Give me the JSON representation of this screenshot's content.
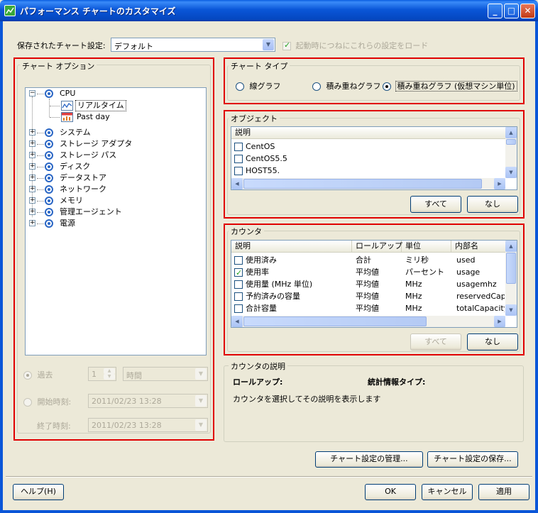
{
  "window": {
    "title": "パフォーマンス チャートのカスタマイズ",
    "minimize": "_",
    "maximize": "□",
    "close": "✕"
  },
  "saved_settings": {
    "label": "保存されたチャート設定:",
    "value": "デフォルト",
    "load_on_startup": "起動時につねにこれらの設定をロード"
  },
  "chart_options": {
    "title": "チャート オプション",
    "tree": {
      "cpu": "CPU",
      "realtime": "リアルタイム",
      "past_day": "Past day",
      "items": [
        "システム",
        "ストレージ アダプタ",
        "ストレージ パス",
        "ディスク",
        "データストア",
        "ネットワーク",
        "メモリ",
        "管理エージェント",
        "電源"
      ]
    },
    "past_label": "過去",
    "past_value": "1",
    "past_unit": "時間",
    "start_label": "開始時刻:",
    "start_value": "2011/02/23 13:28",
    "end_label": "終了時刻:",
    "end_value": "2011/02/23 13:28"
  },
  "chart_type": {
    "title": "チャート タイプ",
    "options": [
      "線グラフ",
      "積み重ねグラフ",
      "積み重ねグラフ (仮想マシン単位)"
    ],
    "selected_index": 2
  },
  "objects": {
    "title": "オブジェクト",
    "header": "説明",
    "items": [
      "CentOS",
      "CentOS5.5",
      "HOST55."
    ],
    "all_button": "すべて",
    "none_button": "なし"
  },
  "counters": {
    "title": "カウンタ",
    "headers": [
      "説明",
      "ロールアップ",
      "単位",
      "内部名"
    ],
    "rows": [
      {
        "desc": "使用済み",
        "rollup": "合計",
        "unit": "ミリ秒",
        "internal": "used",
        "checked": false
      },
      {
        "desc": "使用率",
        "rollup": "平均値",
        "unit": "パーセント",
        "internal": "usage",
        "checked": true
      },
      {
        "desc": "使用量 (MHz 単位)",
        "rollup": "平均値",
        "unit": "MHz",
        "internal": "usagemhz",
        "checked": false
      },
      {
        "desc": "予約済みの容量",
        "rollup": "平均値",
        "unit": "MHz",
        "internal": "reservedCapa",
        "checked": false
      },
      {
        "desc": "合計容量",
        "rollup": "平均値",
        "unit": "MHz",
        "internal": "totalCapacity",
        "checked": false
      }
    ],
    "all_button": "すべて",
    "none_button": "なし"
  },
  "counter_desc": {
    "title": "カウンタの説明",
    "rollup_label": "ロールアップ:",
    "stat_type_label": "統計情報タイプ:",
    "text": "カウンタを選択してその説明を表示します"
  },
  "buttons": {
    "manage": "チャート設定の管理...",
    "save": "チャート設定の保存...",
    "help": "ヘルプ(H)",
    "ok": "OK",
    "cancel": "キャンセル",
    "apply": "適用"
  },
  "icons": {
    "app": "chart-app-icon",
    "cpu": "target-icon",
    "realtime": "line-chart-icon",
    "pastday": "calendar-chart-icon"
  }
}
